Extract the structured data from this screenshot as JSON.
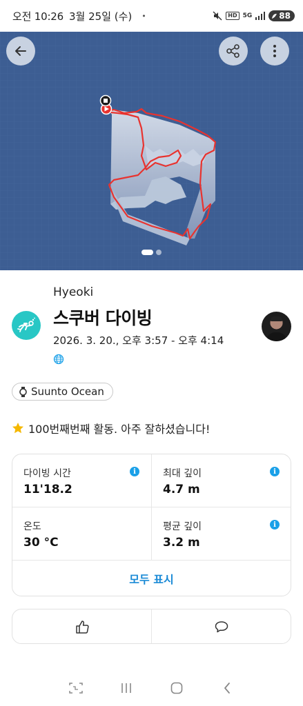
{
  "status_bar": {
    "time": "오전 10:26",
    "date": "3월 25일 (수)",
    "indicator": "•",
    "hd_label": "HD",
    "network": "5G",
    "battery": "88",
    "icons": [
      "mute-icon",
      "hd-voice-icon",
      "5g-icon",
      "signal-icon",
      "battery-icon"
    ]
  },
  "map": {
    "icons": [
      "back-arrow-icon",
      "share-icon",
      "more-vertical-icon",
      "stop-marker-icon",
      "start-marker-icon"
    ],
    "route_color": "#e8332f",
    "background_color": "#3d5e93",
    "page_count": 2,
    "current_page": 1
  },
  "activity": {
    "username": "Hyeoki",
    "title": "스쿠버 다이빙",
    "datetime": "2026. 3. 20., 오후 3:57 - 오후 4:14",
    "icon": "scuba-diver-icon",
    "accent_color": "#28c7c5",
    "privacy_icon": "globe-icon"
  },
  "device": {
    "name": "Suunto Ocean",
    "icon": "watch-icon"
  },
  "achievement": {
    "text": "100번째번째 활동. 아주 잘하셨습니다!",
    "icon": "star-icon"
  },
  "stats": [
    {
      "label": "다이빙 시간",
      "value": "11'18.2"
    },
    {
      "label": "최대 깊이",
      "value": "4.7 m"
    },
    {
      "label": "온도",
      "value": "30 °C"
    },
    {
      "label": "평균 깊이",
      "value": "3.2 m"
    }
  ],
  "info_glyph": "i",
  "show_all_label": "모두 표시",
  "actions": {
    "icons": [
      "thumbs-up-icon",
      "comment-icon"
    ]
  },
  "nav": {
    "icons": [
      "screen-capture-icon",
      "recents-icon",
      "home-icon",
      "back-icon"
    ]
  }
}
